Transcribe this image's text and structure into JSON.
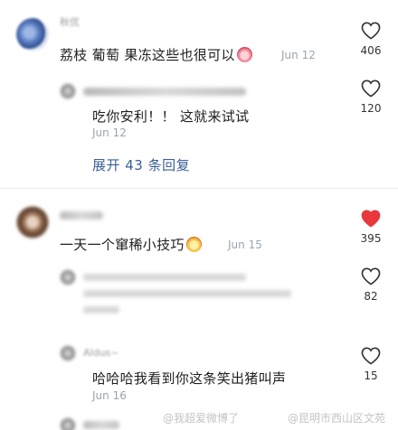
{
  "comments": [
    {
      "username": "秋优",
      "text": "荔枝 葡萄 果冻这些也很可以",
      "date": "Jun 12",
      "likes": "406",
      "emoji": "pig-emoji"
    },
    {
      "text": "吃你安利！！ 这就来试试",
      "date": "Jun 12",
      "likes": "120"
    },
    {
      "text": "一天一个窜稀小技巧",
      "date": "Jun 15",
      "likes": "395",
      "liked": true,
      "emoji": "crying-emoji"
    },
    {
      "likes": "82"
    },
    {
      "username": "Aldus~",
      "text": "哈哈哈我看到你这条笑出猪叫声",
      "date": "Jun 16",
      "likes": "15"
    }
  ],
  "expand_replies": "展开 43 条回复",
  "watermarks": [
    "@我超爱微博了",
    "@昆明市西山区文苑"
  ],
  "colors": {
    "accent_link": "#3a5f97",
    "liked_heart": "#e8383d",
    "date_gray": "#9aa4b2"
  }
}
